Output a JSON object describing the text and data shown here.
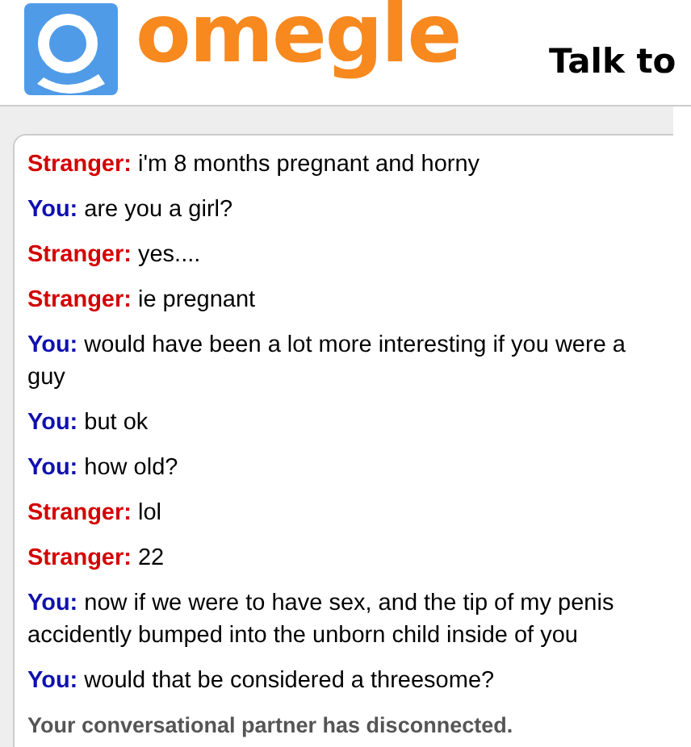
{
  "header": {
    "logo_text": "omegle",
    "tagline": "Talk to"
  },
  "messages": [
    {
      "kind": "stranger",
      "speaker": "Stranger:",
      "text": "i'm 8 months pregnant and horny"
    },
    {
      "kind": "you",
      "speaker": "You:",
      "text": "are you a girl?"
    },
    {
      "kind": "stranger",
      "speaker": "Stranger:",
      "text": "yes...."
    },
    {
      "kind": "stranger",
      "speaker": "Stranger:",
      "text": "ie pregnant"
    },
    {
      "kind": "you",
      "speaker": "You:",
      "text": "would have been a lot more interesting if you were a guy"
    },
    {
      "kind": "you",
      "speaker": "You:",
      "text": "but ok"
    },
    {
      "kind": "you",
      "speaker": "You:",
      "text": "how old?"
    },
    {
      "kind": "stranger",
      "speaker": "Stranger:",
      "text": "lol"
    },
    {
      "kind": "stranger",
      "speaker": "Stranger:",
      "text": "22"
    },
    {
      "kind": "you",
      "speaker": "You:",
      "text": "now if we were to have sex, and the tip of my penis accidently bumped into the unborn child inside of you"
    },
    {
      "kind": "you",
      "speaker": "You:",
      "text": "would that be considered a threesome?"
    }
  ],
  "status": "Your conversational partner has disconnected."
}
